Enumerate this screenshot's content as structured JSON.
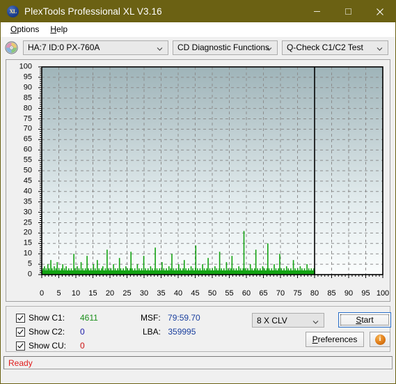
{
  "window": {
    "title": "PlexTools Professional XL V3.16",
    "icon": "XL",
    "minimize_label": "minimize",
    "maximize_label": "maximize",
    "close_label": "close"
  },
  "menu": {
    "items": [
      {
        "label": "Options",
        "accel": "O"
      },
      {
        "label": "Help",
        "accel": "H"
      }
    ]
  },
  "toolbar": {
    "drive_selector": "HA:7 ID:0  PX-760A",
    "function_selector": "CD Diagnostic Functions",
    "test_selector": "Q-Check C1/C2 Test"
  },
  "chart_data": {
    "type": "area",
    "title": "",
    "xlabel": "",
    "ylabel": "",
    "xlim": [
      0,
      100
    ],
    "ylim": [
      0,
      100
    ],
    "xticks": [
      0,
      5,
      10,
      15,
      20,
      25,
      30,
      35,
      40,
      45,
      50,
      55,
      60,
      65,
      70,
      75,
      80,
      85,
      90,
      95,
      100
    ],
    "yticks": [
      0,
      5,
      10,
      15,
      20,
      25,
      30,
      35,
      40,
      45,
      50,
      55,
      60,
      65,
      70,
      75,
      80,
      85,
      90,
      95,
      100
    ],
    "grid": true,
    "legend": "none",
    "series_color": "#13a313",
    "plot_bg_top": "#9fb4b9",
    "plot_bg_bottom": "#fbfdfd",
    "disc_end_marker_x": 80,
    "data_end_x": 80,
    "series": [
      {
        "name": "C1",
        "color": "#13a313",
        "x_step": 0.25,
        "values": [
          2,
          1,
          3,
          1,
          2,
          4,
          1,
          2,
          1,
          3,
          1,
          2,
          1,
          5,
          2,
          1,
          3,
          1,
          2,
          1,
          7,
          2,
          1,
          3,
          1,
          2,
          1,
          2,
          4,
          1,
          2,
          1,
          3,
          1,
          2,
          6,
          1,
          2,
          1,
          3,
          1,
          2,
          1,
          2,
          1,
          3,
          1,
          2,
          5,
          1,
          2,
          1,
          3,
          1,
          2,
          1,
          4,
          1,
          2,
          1,
          2,
          1,
          3,
          1,
          2,
          1,
          2,
          1,
          3,
          1,
          2,
          1,
          2,
          1,
          10,
          2,
          1,
          3,
          1,
          2,
          1,
          2,
          4,
          1,
          2,
          1,
          3,
          1,
          2,
          1,
          2,
          6,
          1,
          2,
          1,
          3,
          1,
          2,
          1,
          2,
          1,
          3,
          1,
          2,
          1,
          9,
          2,
          1,
          3,
          1,
          2,
          1,
          2,
          1,
          3,
          1,
          2,
          1,
          2,
          1,
          5,
          1,
          2,
          1,
          3,
          1,
          2,
          1,
          2,
          7,
          1,
          2,
          1,
          3,
          1,
          2,
          1,
          2,
          1,
          3,
          1,
          2,
          4,
          1,
          2,
          1,
          2,
          1,
          3,
          1,
          2,
          1,
          12,
          2,
          1,
          3,
          1,
          2,
          1,
          2,
          1,
          3,
          1,
          2,
          1,
          2,
          1,
          5,
          1,
          2,
          1,
          3,
          1,
          2,
          1,
          2,
          1,
          3,
          1,
          2,
          1,
          8,
          2,
          1,
          3,
          1,
          2,
          1,
          2,
          1,
          3,
          1,
          2,
          1,
          2,
          1,
          4,
          1,
          2,
          1,
          3,
          1,
          2,
          1,
          2,
          1,
          3,
          1,
          11,
          2,
          1,
          3,
          1,
          2,
          1,
          2,
          1,
          3,
          1,
          2,
          1,
          2,
          1,
          5,
          1,
          2,
          1,
          3,
          1,
          2,
          1,
          2,
          1,
          3,
          1,
          2,
          1,
          2,
          9,
          1,
          2,
          1,
          3,
          1,
          2,
          1,
          2,
          1,
          3,
          1,
          2,
          1,
          2,
          1,
          4,
          1,
          2,
          1,
          3,
          1,
          2,
          1,
          2,
          1,
          3,
          13,
          1,
          2,
          1,
          3,
          1,
          2,
          1,
          2,
          1,
          3,
          1,
          2,
          1,
          2,
          1,
          6,
          1,
          2,
          1,
          3,
          1,
          2,
          1,
          2,
          1,
          3,
          1,
          2,
          1,
          2,
          1,
          4,
          1,
          2,
          1,
          3,
          1,
          2,
          10,
          1,
          2,
          1,
          3,
          1,
          2,
          1,
          2,
          1,
          3,
          1,
          2,
          1,
          2,
          1,
          5,
          1,
          2,
          1,
          3,
          1,
          2,
          1,
          2,
          1,
          3,
          1,
          2,
          7,
          1,
          2,
          1,
          3,
          1,
          2,
          1,
          2,
          1,
          3,
          1,
          2,
          1,
          2,
          1,
          4,
          1,
          2,
          1,
          3,
          1,
          2,
          1,
          2,
          1,
          3,
          14,
          1,
          2,
          1,
          3,
          1,
          2,
          1,
          2,
          1,
          3,
          1,
          2,
          1,
          2,
          1,
          5,
          1,
          2,
          1,
          3,
          1,
          2,
          1,
          2,
          1,
          3,
          1,
          2,
          8,
          1,
          2,
          1,
          3,
          1,
          2,
          1,
          2,
          1,
          3,
          1,
          2,
          1,
          2,
          1,
          4,
          1,
          2,
          1,
          3,
          1,
          2,
          1,
          2,
          1,
          3,
          11,
          1,
          2,
          1,
          3,
          1,
          2,
          1,
          2,
          1,
          3,
          1,
          2,
          1,
          2,
          1,
          6,
          1,
          2,
          1,
          3,
          1,
          2,
          1,
          2,
          1,
          3,
          1,
          2,
          9,
          1,
          2,
          1,
          3,
          1,
          2,
          1,
          2,
          1,
          3,
          1,
          2,
          1,
          2,
          1,
          4,
          1,
          2,
          1,
          3,
          1,
          2,
          1,
          2,
          1,
          3,
          1,
          21,
          2,
          1,
          3,
          1,
          2,
          1,
          2,
          1,
          3,
          1,
          2,
          1,
          2,
          1,
          5,
          1,
          2,
          1,
          3,
          1,
          2,
          1,
          2,
          1,
          3,
          1,
          2,
          12,
          1,
          2,
          1,
          3,
          1,
          2,
          1,
          2,
          1,
          3,
          1,
          2,
          1,
          2,
          1,
          4,
          1,
          2,
          1,
          3,
          1,
          2,
          1,
          2,
          1,
          3,
          1,
          15,
          2,
          1,
          3,
          1,
          2,
          1,
          2,
          1,
          3,
          1,
          2,
          1,
          2,
          1,
          5,
          1,
          2,
          1,
          3,
          1,
          2,
          1,
          2,
          1,
          3,
          1,
          2,
          10,
          1,
          2,
          1,
          3,
          1,
          2,
          1,
          2,
          1,
          3,
          1,
          2,
          1,
          2,
          1,
          4,
          1,
          2,
          1,
          3,
          1,
          2,
          1,
          2,
          1,
          3,
          1,
          2,
          1,
          2,
          1,
          7,
          1,
          2,
          1,
          3,
          1,
          2,
          1,
          2,
          1,
          3,
          1,
          2,
          1,
          2,
          1,
          4,
          1,
          2,
          1,
          3,
          1,
          2,
          1,
          2,
          1,
          3,
          1,
          2,
          1,
          2,
          1,
          5,
          1,
          2,
          1,
          3,
          1,
          2,
          1,
          2,
          1,
          3,
          1,
          2,
          1,
          2,
          1,
          3,
          1,
          2
        ]
      }
    ]
  },
  "controls": {
    "checkboxes": [
      {
        "label": "Show C1:",
        "checked": true,
        "value": "4611",
        "color": "#1a8f1a"
      },
      {
        "label": "Show C2:",
        "checked": true,
        "value": "0",
        "color": "#1a1aa8"
      },
      {
        "label": "Show CU:",
        "checked": true,
        "value": "0",
        "color": "#cc1111"
      }
    ],
    "readouts": [
      {
        "key": "MSF:",
        "value": "79:59.70"
      },
      {
        "key": "LBA:",
        "value": "359995"
      }
    ],
    "speed_selector": "8 X CLV",
    "start_label": "Start",
    "start_accel": "S",
    "preferences_label": "Preferences",
    "preferences_accel": "P",
    "info_label": "i"
  },
  "statusbar": {
    "text": "Ready"
  }
}
